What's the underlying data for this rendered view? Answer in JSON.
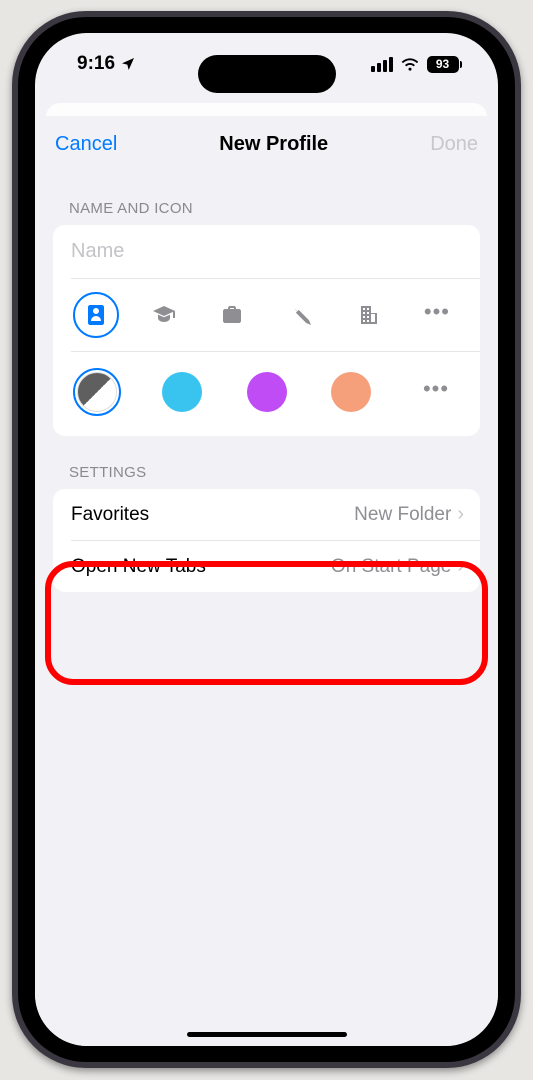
{
  "status": {
    "time": "9:16",
    "battery_percent": "93"
  },
  "sheet": {
    "cancel": "Cancel",
    "title": "New Profile",
    "done": "Done"
  },
  "sections": {
    "name_icon_label": "NAME AND ICON",
    "settings_label": "SETTINGS"
  },
  "name_field": {
    "placeholder": "Name",
    "value": ""
  },
  "icons": [
    {
      "name": "badge-icon",
      "selected": true
    },
    {
      "name": "graduation-cap-icon",
      "selected": false
    },
    {
      "name": "briefcase-icon",
      "selected": false
    },
    {
      "name": "hammer-icon",
      "selected": false
    },
    {
      "name": "building-icon",
      "selected": false
    }
  ],
  "icons_more": "•••",
  "colors": [
    {
      "name": "two-tone",
      "hex": "",
      "selected": true
    },
    {
      "name": "blue",
      "hex": "#39c4ef",
      "selected": false
    },
    {
      "name": "purple",
      "hex": "#c04cf5",
      "selected": false
    },
    {
      "name": "orange",
      "hex": "#f5a07a",
      "selected": false
    }
  ],
  "colors_more": "•••",
  "settings": {
    "rows": [
      {
        "label": "Favorites",
        "value": "New Folder"
      },
      {
        "label": "Open New Tabs",
        "value": "On Start Page"
      }
    ]
  }
}
